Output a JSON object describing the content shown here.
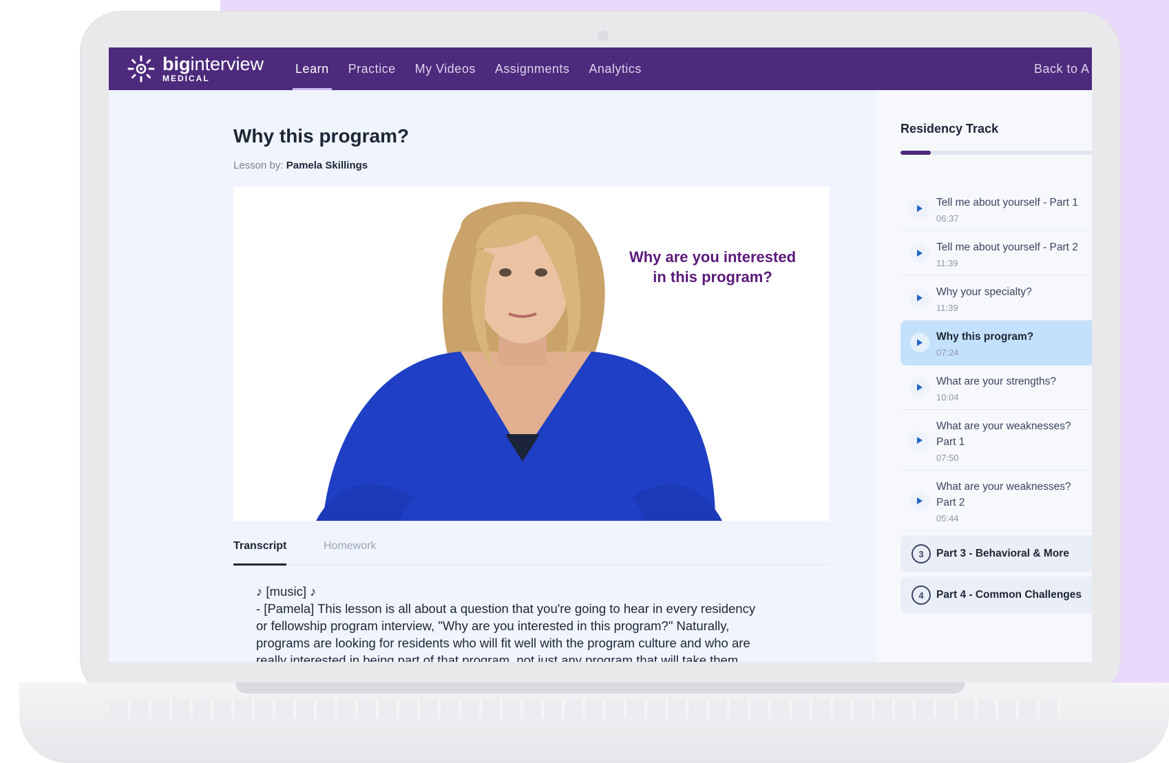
{
  "app": {
    "logo_main_bold": "big",
    "logo_main_rest": "interview",
    "logo_sub": "MEDICAL"
  },
  "nav": {
    "items": [
      {
        "label": "Learn",
        "active": true
      },
      {
        "label": "Practice",
        "active": false
      },
      {
        "label": "My Videos",
        "active": false
      },
      {
        "label": "Assignments",
        "active": false
      },
      {
        "label": "Analytics",
        "active": false
      }
    ],
    "back_label": "Back to A"
  },
  "lesson": {
    "title": "Why this program?",
    "by_prefix": "Lesson by:",
    "author": "Pamela Skillings",
    "video_caption_line1": "Why are you interested",
    "video_caption_line2_pre": "in ",
    "video_caption_line2_bold": "this",
    "video_caption_line2_post": " program?"
  },
  "tabs": {
    "transcript": "Transcript",
    "homework": "Homework"
  },
  "transcript": {
    "line1": "♪ [music] ♪",
    "line2": "- [Pamela] This lesson is all about a question that you're going to hear in every residency",
    "line3": "or fellowship program interview, \"Why are you interested in this program?\" Naturally,",
    "line4": "programs are looking for residents who will fit well with the program culture and who are",
    "line5": "really interested in being part of that program, not just any program that will take them."
  },
  "sidebar": {
    "title": "Residency Track",
    "progress": 0.16,
    "lessons": [
      {
        "name": "Tell me about yourself - Part 1",
        "time": "06:37"
      },
      {
        "name": "Tell me about yourself - Part 2",
        "time": "11:39"
      },
      {
        "name": "Why your specialty?",
        "time": "11:39"
      },
      {
        "name": "Why this program?",
        "time": "07:24",
        "current": true
      },
      {
        "name": "What are your strengths?",
        "time": "10:04"
      },
      {
        "name": "What are your weaknesses?",
        "name2": "Part 1",
        "time": "07:50"
      },
      {
        "name": "What are your weaknesses?",
        "name2": "Part 2",
        "time": "05:44"
      }
    ],
    "parts": [
      {
        "num": "3",
        "label": "Part 3 - Behavioral & More"
      },
      {
        "num": "4",
        "label": "Part 4 - Common Challenges"
      }
    ]
  },
  "colors": {
    "nav_bg": "#4d2a7c",
    "accent_blue": "#2266c8",
    "current_item_bg": "#c3e1fb",
    "shirt_blue": "#1f3fc4"
  },
  "icons": [
    "sun-logo-icon",
    "play-icon"
  ]
}
